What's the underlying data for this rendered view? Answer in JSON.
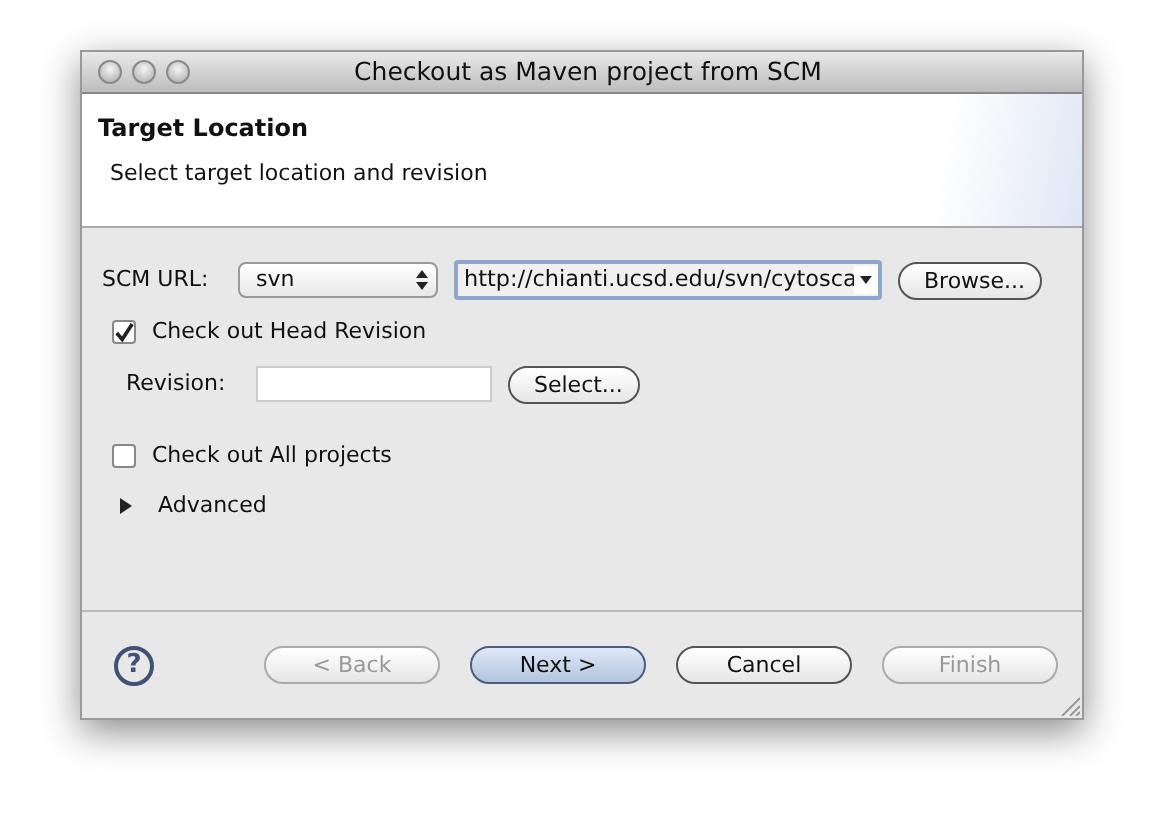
{
  "window": {
    "title": "Checkout as Maven project from SCM"
  },
  "header": {
    "title": "Target Location",
    "description": "Select target location and revision"
  },
  "scm": {
    "label": "SCM URL:",
    "type": "svn",
    "url": "http://chianti.ucsd.edu/svn/cytosca",
    "browse": "Browse..."
  },
  "head_revision": {
    "label": "Check out Head Revision",
    "checked": true
  },
  "revision": {
    "label": "Revision:",
    "select": "Select..."
  },
  "all_projects": {
    "label": "Check out All projects",
    "checked": false
  },
  "advanced": {
    "label": "Advanced",
    "expanded": false
  },
  "help": "?",
  "buttons": [
    {
      "label": "< Back",
      "disabled": true,
      "default": false
    },
    {
      "label": "Next >",
      "disabled": false,
      "default": true
    },
    {
      "label": "Cancel",
      "disabled": false,
      "default": false
    },
    {
      "label": "Finish",
      "disabled": true,
      "default": false
    }
  ]
}
